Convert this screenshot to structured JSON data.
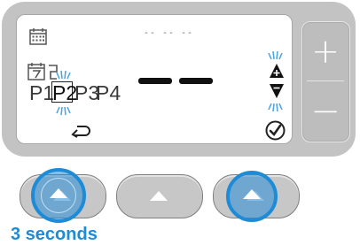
{
  "display": {
    "program_labels": [
      "P1",
      "P2",
      "P3",
      "P4"
    ],
    "selected_program": "P2",
    "time_placeholder": "-- -- --",
    "value_placeholder": "— —"
  },
  "side_buttons": {
    "plus_label": "+",
    "minus_label": "−"
  },
  "caption": "3 seconds",
  "colors": {
    "bezel": "#c3c3c3",
    "screen": "#ffffff",
    "highlight": "#1d8bd6",
    "blink_marks": "#4aa3e0"
  },
  "icons": [
    "calendar-icon",
    "schedule-calendar-icon",
    "back-arrow-icon",
    "confirm-check-icon",
    "up-arrow-icon",
    "down-arrow-icon"
  ]
}
